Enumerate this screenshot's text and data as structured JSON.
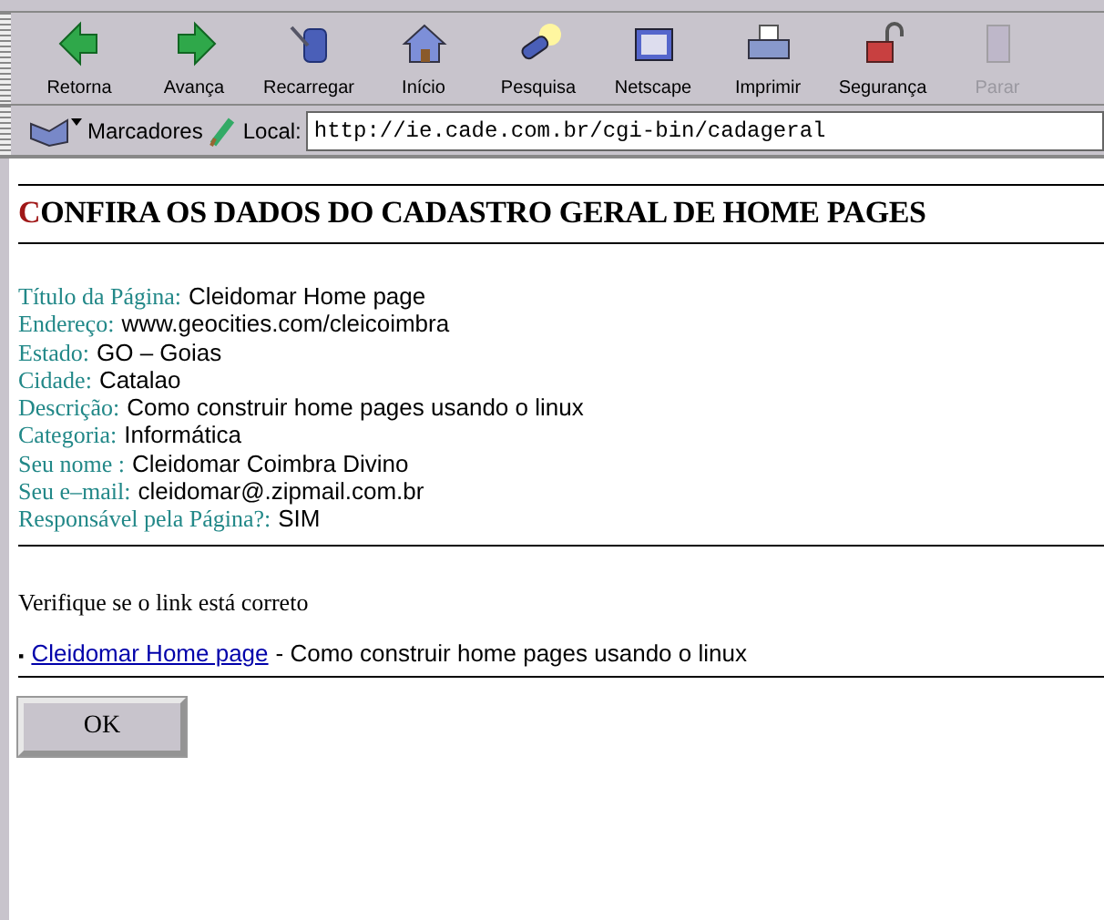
{
  "toolbar": [
    {
      "label": "Retorna",
      "disabled": false
    },
    {
      "label": "Avança",
      "disabled": false
    },
    {
      "label": "Recarregar",
      "disabled": false
    },
    {
      "label": "Início",
      "disabled": false
    },
    {
      "label": "Pesquisa",
      "disabled": false
    },
    {
      "label": "Netscape",
      "disabled": false
    },
    {
      "label": "Imprimir",
      "disabled": false
    },
    {
      "label": "Segurança",
      "disabled": false
    },
    {
      "label": "Parar",
      "disabled": true
    }
  ],
  "location_bar": {
    "bookmarks": "Marcadores",
    "location_label": "Local:",
    "url": "http://ie.cade.com.br/cgi-bin/cadageral"
  },
  "page": {
    "title": "CONFIRA OS DADOS DO CADASTRO GERAL DE HOME PAGES",
    "fields": [
      {
        "label": "Título da Página:",
        "value": "Cleidomar Home page"
      },
      {
        "label": "Endereço:",
        "value": "www.geocities.com/cleicoimbra"
      },
      {
        "label": "Estado:",
        "value": "GO – Goias"
      },
      {
        "label": "Cidade:",
        "value": "Catalao"
      },
      {
        "label": "Descrição:",
        "value": "Como construir home pages usando o linux"
      },
      {
        "label": "Categoria:",
        "value": "Informática"
      },
      {
        "label": "Seu nome :",
        "value": "Cleidomar Coimbra Divino"
      },
      {
        "label": "Seu e–mail:",
        "value": "cleidomar@.zipmail.com.br"
      },
      {
        "label": "Responsável pela Página?:",
        "value": "SIM"
      }
    ],
    "verify_text": "Verifique se o link está correto",
    "link_item": {
      "bullet": "▪",
      "link": "Cleidomar Home page",
      "description": "- Como construir home pages usando o linux"
    },
    "ok_button": "OK"
  }
}
